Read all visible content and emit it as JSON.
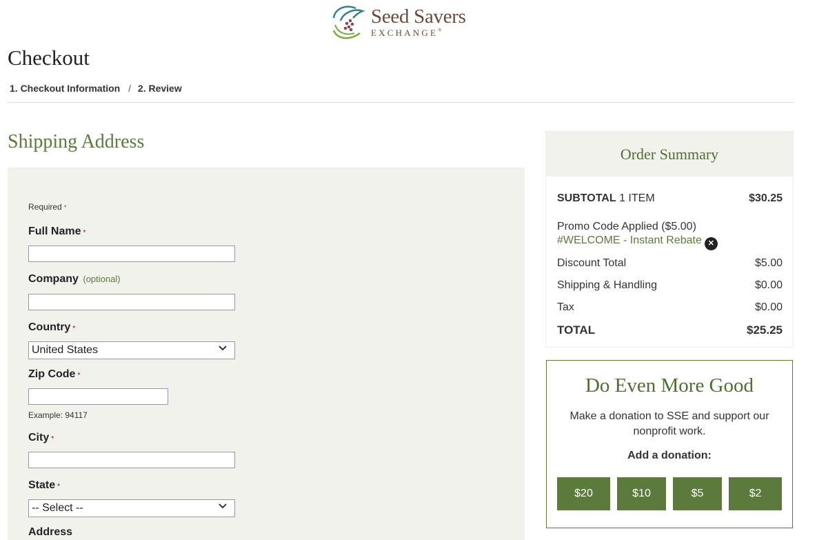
{
  "brand": {
    "name": "Seed Savers",
    "subtitle": "EXCHANGE",
    "reg_mark": "®"
  },
  "page": {
    "title": "Checkout"
  },
  "breadcrumb": {
    "step1": "1. Checkout Information",
    "separator": "/",
    "step2": "2. Review"
  },
  "shipping": {
    "title": "Shipping Address",
    "required_note": "Required",
    "required_mark": "*",
    "full_name": {
      "label": "Full Name",
      "value": ""
    },
    "company": {
      "label": "Company",
      "optional": "(optional)",
      "value": ""
    },
    "country": {
      "label": "Country",
      "value": "United States"
    },
    "zip": {
      "label": "Zip Code",
      "value": "",
      "hint": "Example: 94117"
    },
    "city": {
      "label": "City",
      "value": ""
    },
    "state": {
      "label": "State",
      "value": "-- Select --"
    },
    "address": {
      "label": "Address"
    }
  },
  "summary": {
    "title": "Order Summary",
    "subtotal_label": "SUBTOTAL",
    "subtotal_items": "1 ITEM",
    "subtotal_amount": "$30.25",
    "promo_label": "Promo Code Applied ($5.00)",
    "promo_code": "#WELCOME - Instant Rebate",
    "discount_label": "Discount Total",
    "discount_amount": "$5.00",
    "shipping_label": "Shipping & Handling",
    "shipping_amount": "$0.00",
    "tax_label": "Tax",
    "tax_amount": "$0.00",
    "total_label": "TOTAL",
    "total_amount": "$25.25"
  },
  "donation": {
    "title": "Do Even More Good",
    "text": "Make a donation to SSE and support our nonprofit work.",
    "label": "Add a donation:",
    "options": [
      "$20",
      "$10",
      "$5",
      "$2"
    ]
  },
  "icons": {
    "logo": "seed-hand-logo-icon",
    "chevron": "chevron-down-icon",
    "remove": "close-circle-icon"
  },
  "colors": {
    "brand_green": "#5b7a3b",
    "brand_brown": "#6b4a3a",
    "panel_bg": "#f2f2ed",
    "required_red": "#b84a4a"
  }
}
